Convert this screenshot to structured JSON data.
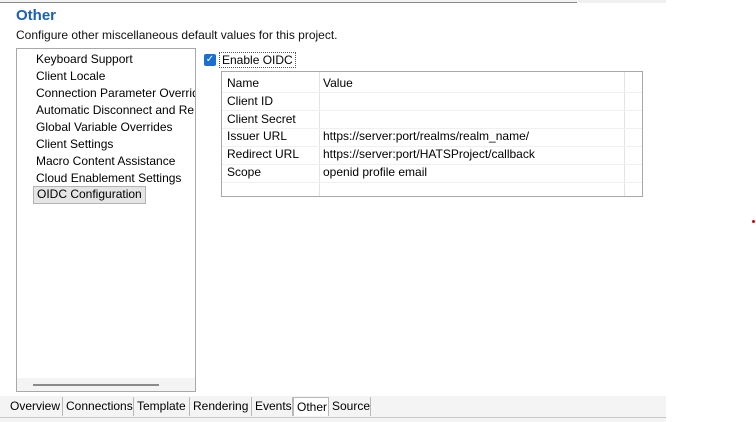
{
  "section": {
    "title": "Other",
    "description": "Configure other miscellaneous default values for this project."
  },
  "list": {
    "items": [
      "Keyboard Support",
      "Client Locale",
      "Connection Parameter Overrid",
      "Automatic Disconnect and Re",
      "Global Variable Overrides",
      "Client Settings",
      "Macro Content Assistance",
      "Cloud Enablement Settings",
      "OIDC Configuration"
    ],
    "selected": "OIDC Configuration"
  },
  "oidc": {
    "checkbox_label": "Enable OIDC",
    "checked": true,
    "columns": [
      "Name",
      "Value"
    ],
    "rows": [
      {
        "name": "Client ID",
        "value": ""
      },
      {
        "name": "Client Secret",
        "value": ""
      },
      {
        "name": "Issuer URL",
        "value": "https://server:port/realms/realm_name/"
      },
      {
        "name": "Redirect URL",
        "value": "https://server:port/HATSProject/callback"
      },
      {
        "name": "Scope",
        "value": "openid profile email"
      }
    ]
  },
  "tabs": [
    "Overview",
    "Connections",
    "Template",
    "Rendering",
    "Events",
    "Other",
    "Source"
  ],
  "active_tab": "Other",
  "colors": {
    "title": "#1a5fb4",
    "checkbox": "#1a6fd1"
  },
  "icons": {
    "checkbox_mark": "check-icon"
  }
}
